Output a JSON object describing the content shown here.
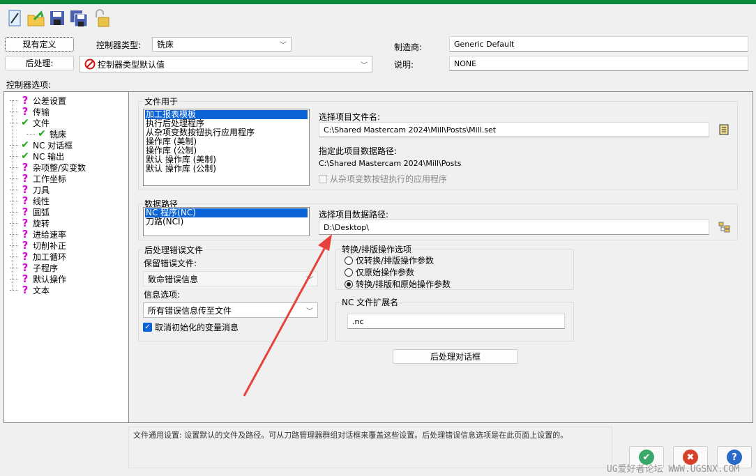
{
  "toolbar": {
    "icons": [
      "new-file-icon",
      "open-folder-icon",
      "save-icon",
      "save-as-icon",
      "lock-icon"
    ]
  },
  "header": {
    "existing_def_label": "现有定义",
    "controller_type_label": "控制器类型:",
    "controller_type_value": "铣床",
    "post_label": "后处理:",
    "post_value": "控制器类型默认值",
    "manufacturer_label": "制造商:",
    "manufacturer_value": "Generic Default",
    "description_label": "说明:",
    "description_value": "NONE",
    "options_label": "控制器选项:"
  },
  "tree": [
    {
      "label": "公差设置",
      "status": "?"
    },
    {
      "label": "传输",
      "status": "?"
    },
    {
      "label": "文件",
      "status": "✔"
    },
    {
      "label": "铣床",
      "status": "✔",
      "child": true
    },
    {
      "label": "NC 对话框",
      "status": "✔"
    },
    {
      "label": "NC 输出",
      "status": "✔"
    },
    {
      "label": "杂项整/实变数",
      "status": "?"
    },
    {
      "label": "工作坐标",
      "status": "?"
    },
    {
      "label": "刀具",
      "status": "?"
    },
    {
      "label": "线性",
      "status": "?"
    },
    {
      "label": "圆弧",
      "status": "?"
    },
    {
      "label": "旋转",
      "status": "?"
    },
    {
      "label": "进给速率",
      "status": "?"
    },
    {
      "label": "切削补正",
      "status": "?"
    },
    {
      "label": "加工循环",
      "status": "?"
    },
    {
      "label": "子程序",
      "status": "?"
    },
    {
      "label": "默认操作",
      "status": "?"
    },
    {
      "label": "文本",
      "status": "?"
    }
  ],
  "files_group": {
    "title": "文件用于",
    "items": [
      "加工报表模板",
      "执行后处理程序",
      "从杂项变数按钮执行应用程序",
      "操作库 (美制)",
      "操作库 (公制)",
      "默认 操作库 (美制)",
      "默认 操作库 (公制)"
    ],
    "select_file_label": "选择项目文件名:",
    "select_file_value": "C:\\Shared Mastercam 2024\\Mill\\Posts\\Mill.set",
    "data_path_label": "指定此项目数据路径:",
    "data_path_value": "C:\\Shared Mastercam 2024\\Mill\\Posts",
    "run_app_checkbox": "从杂项变数按钮执行的应用程序"
  },
  "data_path_group": {
    "title": "数据路径",
    "items": [
      "NC 程序(NC)",
      "刀路(NCI)"
    ],
    "select_path_label": "选择项目数据路径:",
    "select_path_value": "D:\\Desktop\\"
  },
  "error_group": {
    "title": "后处理错误文件",
    "keep_label": "保留错误文件:",
    "keep_value": "致命错误信息",
    "info_label": "信息选项:",
    "info_value": "所有错误信息传至文件",
    "cancel_init_checkbox": "取消初始化的变量消息"
  },
  "convert_group": {
    "title": "转换/排版操作选项",
    "options": [
      "仅转换/排版操作参数",
      "仅原始操作参数",
      "转换/排版和原始操作参数"
    ],
    "selected": 2
  },
  "ext_group": {
    "title": "NC 文件扩展名",
    "value": ".nc"
  },
  "post_dialog_button": "后处理对话框",
  "status_text": "文件通用设置: 设置默认的文件及路径。可从刀路管理器群组对话框来覆盖这些设置。后处理错误信息选项是在此页面上设置的。",
  "buttons": {
    "ok": "✔",
    "cancel": "✖",
    "help": "?"
  },
  "watermark": "UG爱好者论坛 WWW.UGSNX.COM",
  "colors": {
    "accent": "#0a64d8",
    "topbar": "#0a8a3a",
    "arrow": "#e8403a"
  }
}
